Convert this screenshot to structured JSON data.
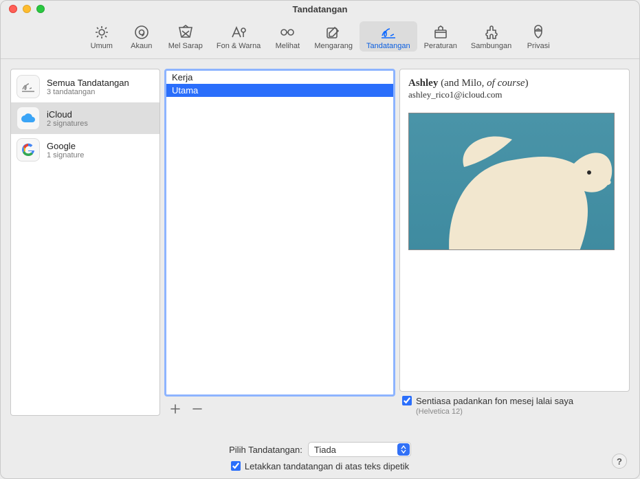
{
  "window": {
    "title": "Tandatangan"
  },
  "toolbar": {
    "items": [
      {
        "key": "general",
        "label": "Umum"
      },
      {
        "key": "accounts",
        "label": "Akaun"
      },
      {
        "key": "junk",
        "label": "Mel Sarap"
      },
      {
        "key": "fonts",
        "label": "Fon & Warna"
      },
      {
        "key": "viewing",
        "label": "Melihat"
      },
      {
        "key": "composing",
        "label": "Mengarang"
      },
      {
        "key": "signatures",
        "label": "Tandatangan"
      },
      {
        "key": "rules",
        "label": "Peraturan"
      },
      {
        "key": "extensions",
        "label": "Sambungan"
      },
      {
        "key": "privacy",
        "label": "Privasi"
      }
    ],
    "active_key": "signatures"
  },
  "accounts": [
    {
      "name": "Semua Tandatangan",
      "sub": "3 tandatangan",
      "icon": "pen",
      "selected": false
    },
    {
      "name": "iCloud",
      "sub": "2 signatures",
      "icon": "cloud",
      "selected": true
    },
    {
      "name": "Google",
      "sub": "1 signature",
      "icon": "google",
      "selected": false
    }
  ],
  "signatures": {
    "list": [
      {
        "name": "Kerja",
        "selected": false
      },
      {
        "name": "Utama",
        "selected": true
      }
    ],
    "buttons": {
      "add": "+",
      "remove": "−"
    }
  },
  "preview": {
    "name_bold": "Ashley",
    "name_plain": " (and Milo, ",
    "name_italic": "of course",
    "name_tail": ")",
    "email": "ashley_rico1@icloud.com"
  },
  "options": {
    "match_font_label": "Sentiasa padankan fon mesej lalai saya",
    "match_font_hint": "(Helvetica 12)",
    "match_font_checked": true,
    "choose_label": "Pilih Tandatangan:",
    "choose_value": "Tiada",
    "above_quoted_label": "Letakkan tandatangan di atas teks dipetik",
    "above_quoted_checked": true
  },
  "help": "?"
}
